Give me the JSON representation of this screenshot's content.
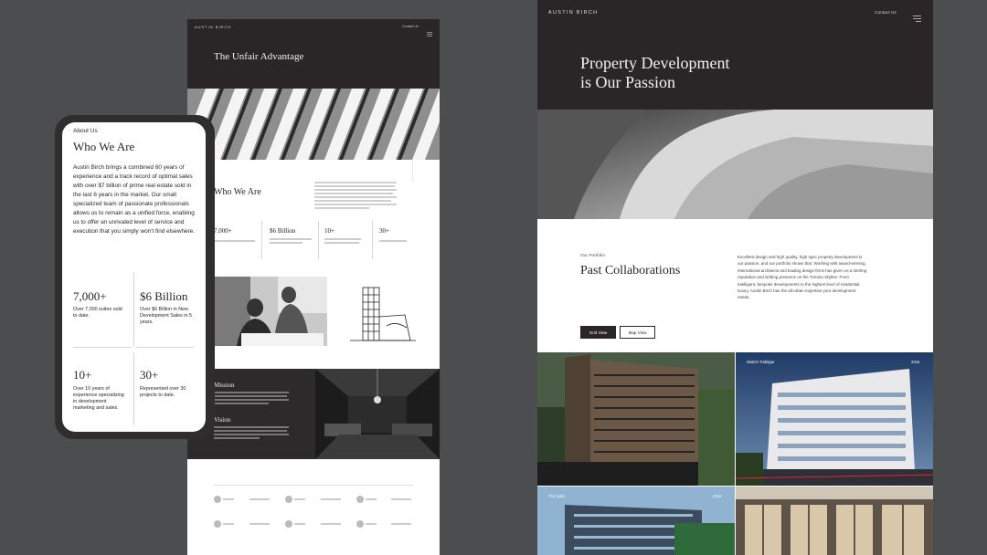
{
  "center_page": {
    "brand": "AUSTIN BIRCH",
    "nav_contact": "Contact Us",
    "hero_title": "The Unfair Advantage",
    "about_eyebrow": "",
    "about_heading": "Who We Are",
    "stats": [
      {
        "value": "7,000+",
        "desc": ""
      },
      {
        "value": "$6 Billion",
        "desc": ""
      },
      {
        "value": "10+",
        "desc": ""
      },
      {
        "value": "30+",
        "desc": ""
      }
    ],
    "mission_heading": "Mission",
    "vision_heading": "Vision",
    "partners_label": ""
  },
  "right_page": {
    "brand": "AUSTIN BIRCH",
    "nav_contact": "Contact Us",
    "hero_title_line1": "Property Development",
    "hero_title_line2": "is Our Passion",
    "portfolio_eyebrow": "Our Portfolio",
    "portfolio_heading": "Past Collaborations",
    "portfolio_body": "Excellent design and high quality, high spec property development is our passion, and our portfolio shows that. Working with award-winning, international architects and leading design firms has given us a sterling reputation and striking presence on the Toronto skyline. From intelligent, bespoke developments to the highest level of residential luxury, Austin Birch has the all-urban expertise your development needs.",
    "grid_view": "Grid View",
    "map_view": "Map View",
    "projects": [
      {
        "name": "",
        "year": ""
      },
      {
        "name": "District Trafalgar",
        "year": "2016"
      },
      {
        "name": "The Quint",
        "year": "2015"
      },
      {
        "name": "",
        "year": ""
      }
    ]
  },
  "mobile": {
    "eyebrow": "About Us",
    "heading": "Who We Are",
    "body": "Austin Birch brings a combined 60 years of experience and a track record of optimal sales with over $7 billion of prime real estate sold in the last 6 years in the market. Our small specialized team of passionate professionals allows us to remain as a unified force, enabling us to offer an unrivaled level of service and execution that you simply won't find elsewhere.",
    "stats": [
      {
        "value": "7,000+",
        "desc": "Over 7,000 suites sold to date."
      },
      {
        "value": "$6 Billion",
        "desc": "Over $6 Billion in New Development Sales in 5 years."
      },
      {
        "value": "10+",
        "desc": "Over 10 years of experience specializing in development marketing and sales."
      },
      {
        "value": "30+",
        "desc": "Represented over 30 projects to date."
      }
    ]
  }
}
